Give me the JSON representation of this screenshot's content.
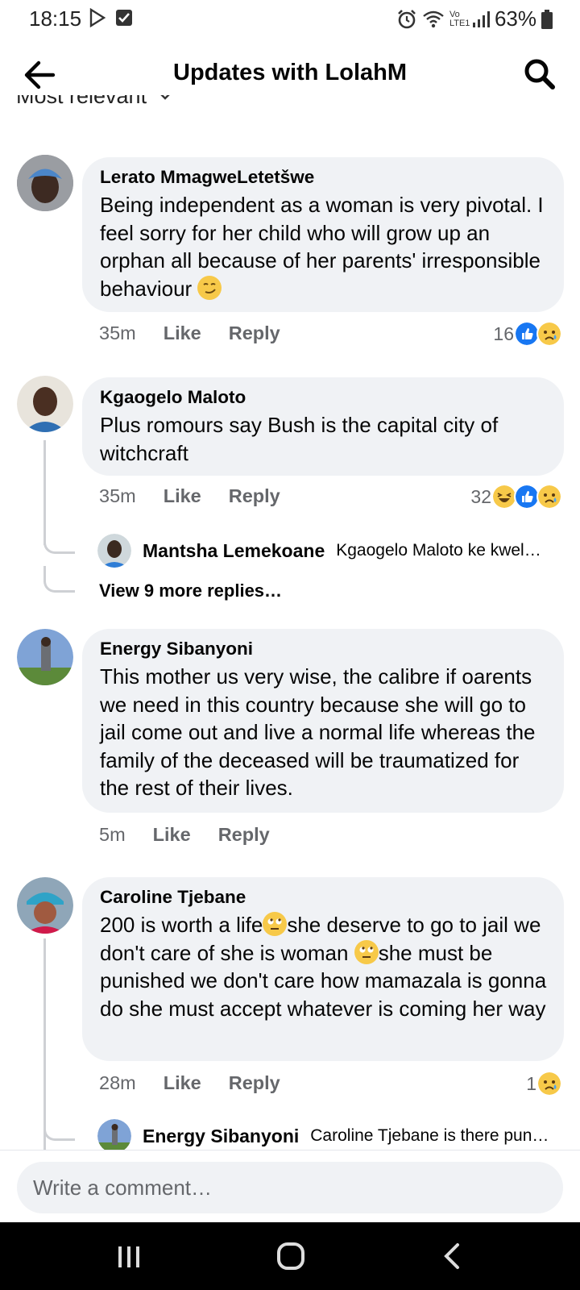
{
  "status_bar": {
    "time": "18:15",
    "battery": "63%",
    "network": "Vo LTE1"
  },
  "header": {
    "title": "Updates with LolahM",
    "back_icon": "arrow-left-icon",
    "search_icon": "search-icon"
  },
  "sort": {
    "label": "Most relevant"
  },
  "comments": [
    {
      "author": "Lerato MmagweLetetšwe",
      "text": "Being independent as a woman is very pivotal. I feel sorry for her child who will grow up an orphan all because of her parents' irresponsible behaviour",
      "time": "35m",
      "like": "Like",
      "reply": "Reply",
      "reaction_count": "16"
    },
    {
      "author": "Kgaogelo Maloto",
      "text": "Plus romours say Bush is the capital city of witchcraft",
      "time": "35m",
      "like": "Like",
      "reply": "Reply",
      "reaction_count": "32",
      "replies": [
        {
          "author": "Mantsha Lemekoane",
          "text": "Kgaogelo Maloto ke kwel…"
        }
      ],
      "view_more": "View 9 more replies…"
    },
    {
      "author": "Energy Sibanyoni",
      "text": "This mother  us very wise,  the calibre if oarents we need in this country because she will go to jail come out and live a normal life whereas the family of the deceased will be traumatized for the rest of their lives.",
      "time": "5m",
      "like": "Like",
      "reply": "Reply"
    },
    {
      "author": "Caroline Tjebane",
      "text_parts": [
        "200 is worth a life",
        "she deserve to go to jail we don't care of she is woman ",
        "she must be punished we don't  care how mamazala is gonna do she must accept whatever is coming her way"
      ],
      "time": "28m",
      "like": "Like",
      "reply": "Reply",
      "reaction_count": "1",
      "replies": [
        {
          "author": "Energy Sibanyoni",
          "text": "Caroline Tjebane is there pun…"
        }
      ]
    }
  ],
  "composer": {
    "placeholder": "Write a comment…"
  },
  "colors": {
    "bubble": "#f0f2f5",
    "like_blue": "#1877f2",
    "meta_gray": "#65676b",
    "emoji_yellow": "#f7c949"
  }
}
